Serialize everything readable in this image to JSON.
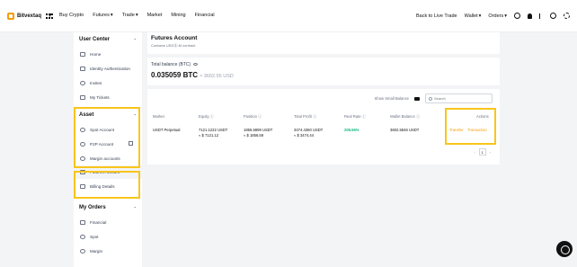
{
  "topnav": {
    "logo": "Bitvextaq",
    "left_items": [
      "Buy Crypto",
      "Futures",
      "Trade",
      "Market",
      "Mining",
      "Financial"
    ],
    "right_items": [
      "Back to Live Trade",
      "Wallet",
      "Orders"
    ]
  },
  "sidebar": {
    "user_center": {
      "header": "User Center",
      "items": [
        {
          "label": "Home",
          "icon": "home-icon"
        },
        {
          "label": "Identity Authentication",
          "icon": "id-card-icon"
        },
        {
          "label": "Invites",
          "icon": "invites-icon"
        },
        {
          "label": "My Tickets",
          "icon": "ticket-icon"
        }
      ]
    },
    "asset": {
      "header": "Asset",
      "items": [
        {
          "label": "Spot Account",
          "icon": "spot-icon"
        },
        {
          "label": "P2P Account",
          "icon": "p2p-icon"
        },
        {
          "label": "Margin accounts",
          "icon": "margin-icon"
        },
        {
          "label": "Futures Account",
          "icon": "futures-icon"
        },
        {
          "label": "Billing Details",
          "icon": "billing-icon"
        }
      ]
    },
    "my_orders": {
      "header": "My Orders",
      "items": [
        {
          "label": "Financial",
          "icon": "financial-icon"
        },
        {
          "label": "Spot",
          "icon": "spot-order-icon"
        },
        {
          "label": "Margin",
          "icon": "margin-order-icon"
        }
      ]
    }
  },
  "header_card": {
    "title": "Futures Account",
    "subtitle": "Contains USDⓈ-M contract"
  },
  "balance": {
    "label": "Total balance (BTC)",
    "value": "0.035059 BTC",
    "usd": "≈ 3602.55 USD"
  },
  "table": {
    "show_small_balance": "Show Small Balance",
    "search_placeholder": "Search",
    "headers": [
      "Market",
      "Equity ⓘ",
      "Position ⓘ",
      "Total Profit ⓘ",
      "Real Rate ⓘ",
      "Wallet Balance ⓘ",
      "Actions"
    ],
    "row": {
      "market": "USDT Perpetual",
      "equity": "7121.1222 USDT",
      "equity_usd": "≈ $ 7121.12",
      "position": "1856.5899 USDT",
      "position_usd": "≈ $ 1856.59",
      "total_profit": "3474.4360 USDT",
      "total_profit_usd": "≈ $ 3474.44",
      "real_rate": "209.56%",
      "wallet_balance": "3602.5846 USDT",
      "action_transfer": "Transfer",
      "action_transaction": "Transaction"
    },
    "page": "1"
  },
  "colors": {
    "accent": "#f59e0b",
    "highlight": "#f8c51c",
    "positive": "#10b981"
  }
}
